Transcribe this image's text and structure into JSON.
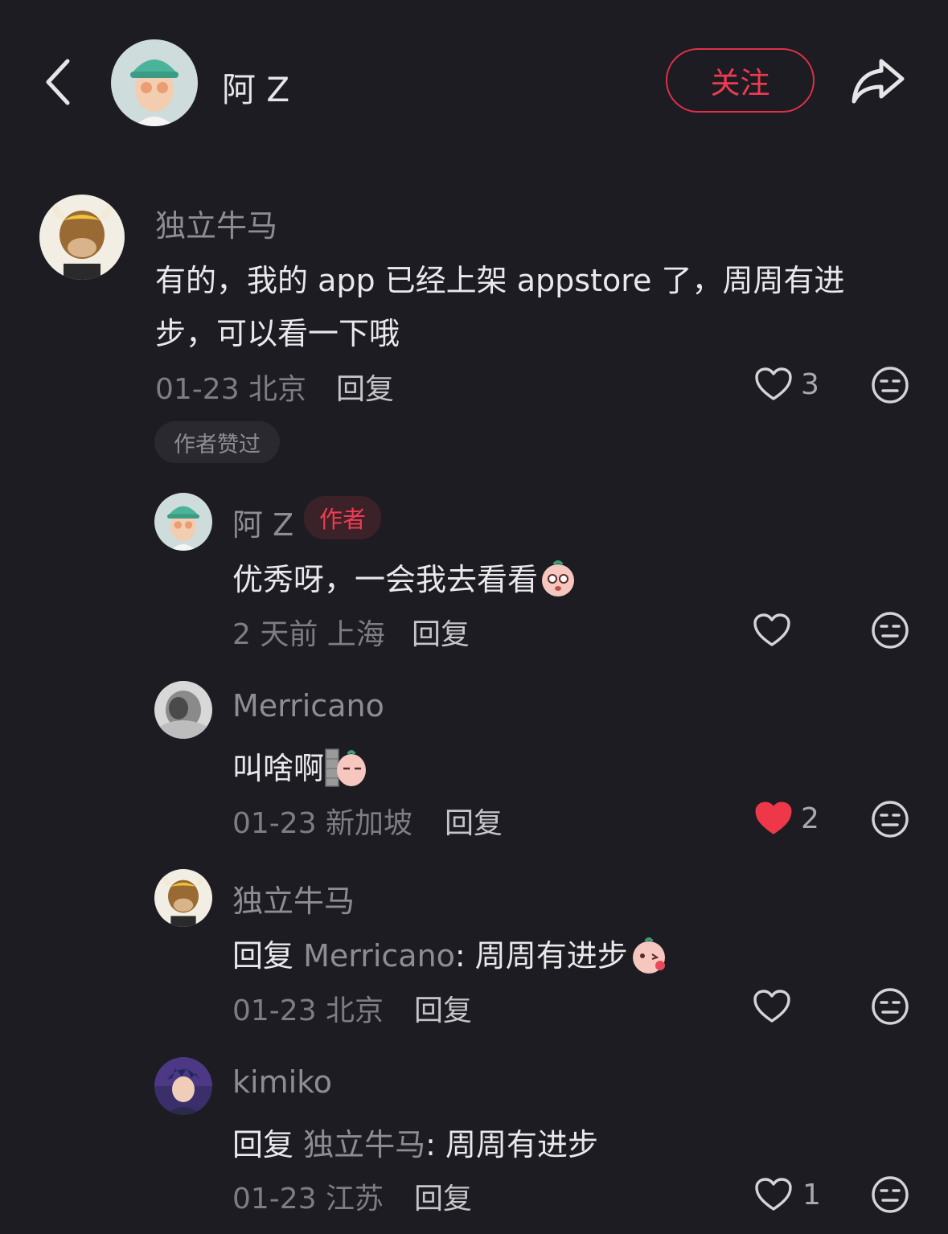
{
  "header": {
    "back_icon": "chevron-left-icon",
    "author_name": "阿 Z",
    "follow_label": "关注",
    "share_icon": "share-icon",
    "accent": "#ef3b52"
  },
  "comment": {
    "user": "独立牛马",
    "text_line1": "有的，我的 app 已经上架 appstore 了，周周有进",
    "text_line2": "步，可以看一下哦",
    "time_location": "01-23 北京",
    "reply_label": "回复",
    "like_count": "3",
    "author_liked_badge": "作者赞过"
  },
  "replies": [
    {
      "user": "阿 Z",
      "author_tag": "作者",
      "text": "优秀呀，一会我去看看",
      "time_location": "2 天前 上海",
      "reply_label": "回复",
      "like_count": ""
    },
    {
      "user": "Merricano",
      "text": "叫啥啊",
      "time_location": "01-23 新加坡",
      "reply_label": "回复",
      "like_count": "2",
      "liked": true
    },
    {
      "user": "独立牛马",
      "reply_prefix": "回复",
      "reply_target": "Merricano",
      "text": ": 周周有进步",
      "time_location": "01-23 北京",
      "reply_label": "回复",
      "like_count": ""
    },
    {
      "user": "kimiko",
      "reply_prefix": "回复",
      "reply_target": "独立牛马",
      "text": ": 周周有进步",
      "time_location": "01-23 江苏",
      "reply_label": "回复",
      "like_count": "1"
    }
  ]
}
